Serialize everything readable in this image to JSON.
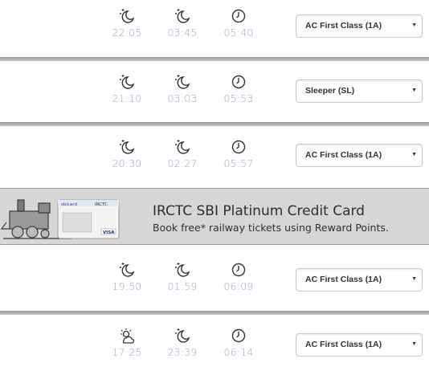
{
  "trains": [
    {
      "departure": "22:05",
      "arrival": "03:45",
      "duration": "05:40",
      "class": "AC First Class (1A)",
      "dep_icon": "moon-icon",
      "arr_icon": "moon-icon"
    },
    {
      "departure": "21:10",
      "arrival": "03:03",
      "duration": "05:53",
      "class": "Sleeper (SL)",
      "dep_icon": "moon-icon",
      "arr_icon": "moon-icon"
    },
    {
      "departure": "20:30",
      "arrival": "02:27",
      "duration": "05:57",
      "class": "AC First Class (1A)",
      "dep_icon": "moon-icon",
      "arr_icon": "moon-icon"
    },
    {
      "departure": "19:50",
      "arrival": "01:59",
      "duration": "06:09",
      "class": "AC First Class (1A)",
      "dep_icon": "moon-icon",
      "arr_icon": "moon-icon"
    },
    {
      "departure": "17:25",
      "arrival": "23:39",
      "duration": "06:14",
      "class": "AC First Class (1A)",
      "dep_icon": "sunset-icon",
      "arr_icon": "moon-icon"
    }
  ],
  "banner": {
    "title": "IRCTC SBI Platinum Credit Card",
    "subtitle": "Book free* railway tickets using Reward Points.",
    "card_brand": "sbicard",
    "card_issuer": "IRCTC",
    "card_network": "VISA"
  },
  "colors": {
    "time_text": "#a3a3c8",
    "separator": "#b0b0b0",
    "banner_bg": "#d6d6d6"
  }
}
